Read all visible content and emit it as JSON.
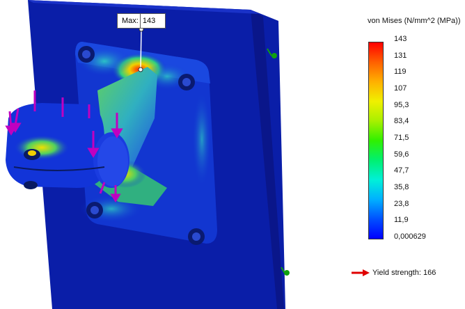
{
  "callout": {
    "label": "Max:",
    "value": "143"
  },
  "legend": {
    "title": "von Mises (N/mm^2 (MPa))",
    "ticks": [
      "143",
      "131",
      "119",
      "107",
      "95,3",
      "83,4",
      "71,5",
      "59,6",
      "47,7",
      "35,8",
      "23,8",
      "11,9",
      "0,000629"
    ],
    "yield_label": "Yield strength: 166",
    "yield_arrow_color": "#e00000"
  },
  "colors": {
    "plate": "#0a20b8",
    "mesh_low": "#1032d8",
    "load_arrow": "#c000c0",
    "fixture": "#10a010"
  },
  "icons": [
    "load-arrow-icon",
    "fixture-icon",
    "yield-arrow-icon"
  ]
}
